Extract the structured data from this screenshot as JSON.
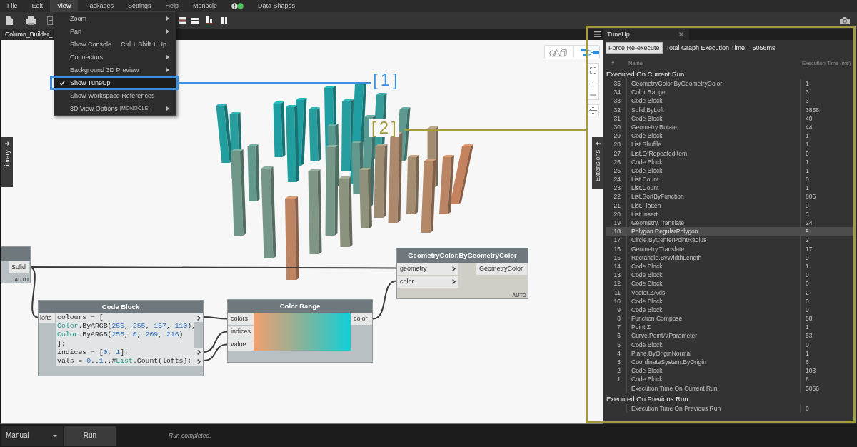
{
  "menu_bar": [
    {
      "kind": "menu",
      "label": "File",
      "open": false
    },
    {
      "kind": "menu",
      "label": "Edit",
      "open": false
    },
    {
      "kind": "menu",
      "label": "View",
      "open": true
    },
    {
      "kind": "menu",
      "label": "Packages",
      "open": false
    },
    {
      "kind": "menu",
      "label": "Settings",
      "open": false
    },
    {
      "kind": "menu",
      "label": "Help",
      "open": false
    },
    {
      "kind": "menu",
      "label": "Monocle",
      "open": false
    },
    {
      "kind": "indicator"
    },
    {
      "kind": "menu",
      "label": "Data Shapes",
      "open": false
    }
  ],
  "view_menu": {
    "items": [
      {
        "label": "Zoom",
        "submenu": true,
        "checked": false,
        "selected": false
      },
      {
        "label": "Pan",
        "submenu": true,
        "checked": false,
        "selected": false
      },
      {
        "label": "Show Console",
        "shortcut": "Ctrl + Shift + Up",
        "submenu": false,
        "checked": false,
        "selected": false
      },
      {
        "label": "Connectors",
        "submenu": true,
        "checked": false,
        "selected": false
      },
      {
        "label": "Background 3D Preview",
        "submenu": true,
        "checked": false,
        "selected": false
      },
      {
        "label": "Show TuneUp",
        "submenu": false,
        "checked": true,
        "selected": true
      },
      {
        "label": "Show Workspace References",
        "submenu": false,
        "checked": false,
        "selected": false
      },
      {
        "label": "3D View Options",
        "tag": "[MONOCLE]",
        "submenu": true,
        "checked": false,
        "selected": false
      }
    ]
  },
  "tabs": [
    {
      "label": "Column_Builder_",
      "selected": true
    }
  ],
  "canvas": {
    "library_tab": {
      "label": "Library"
    },
    "extensions_tab": {
      "label": "Extensions"
    },
    "view_toggle": [
      {
        "kind": "geometry",
        "selected": false
      },
      {
        "kind": "graph",
        "selected": true
      }
    ],
    "nodes": [
      {
        "kind": "partial",
        "outputs": [
          "Solid"
        ],
        "lacing": "AUTO"
      },
      {
        "kind": "code",
        "title": "Code Block",
        "inputs": [
          "lofts"
        ],
        "lines": [
          {
            "output": true,
            "tokens": [
              {
                "kind": "plain",
                "text": "colours = ["
              }
            ]
          },
          {
            "output": false,
            "tokens": [
              {
                "kind": "type",
                "text": "Color"
              },
              {
                "kind": "plain",
                "text": ".ByARGB("
              },
              {
                "kind": "number",
                "text": "255"
              },
              {
                "kind": "plain",
                "text": ", "
              },
              {
                "kind": "number",
                "text": "255"
              },
              {
                "kind": "plain",
                "text": ", "
              },
              {
                "kind": "number",
                "text": "157"
              },
              {
                "kind": "plain",
                "text": ", "
              },
              {
                "kind": "number",
                "text": "110"
              },
              {
                "kind": "plain",
                "text": "),"
              }
            ]
          },
          {
            "output": false,
            "tokens": [
              {
                "kind": "type",
                "text": "Color"
              },
              {
                "kind": "plain",
                "text": ".ByARGB("
              },
              {
                "kind": "number",
                "text": "255"
              },
              {
                "kind": "plain",
                "text": ", "
              },
              {
                "kind": "number",
                "text": "0"
              },
              {
                "kind": "plain",
                "text": ", "
              },
              {
                "kind": "number",
                "text": "209"
              },
              {
                "kind": "plain",
                "text": ", "
              },
              {
                "kind": "number",
                "text": "216"
              },
              {
                "kind": "plain",
                "text": ")"
              }
            ]
          },
          {
            "output": false,
            "tokens": [
              {
                "kind": "plain",
                "text": "];"
              }
            ]
          },
          {
            "output": true,
            "tokens": [
              {
                "kind": "plain",
                "text": "indices = ["
              },
              {
                "kind": "number",
                "text": "0"
              },
              {
                "kind": "plain",
                "text": ", "
              },
              {
                "kind": "number",
                "text": "1"
              },
              {
                "kind": "plain",
                "text": "];"
              }
            ]
          },
          {
            "output": true,
            "tokens": [
              {
                "kind": "plain",
                "text": "vals = "
              },
              {
                "kind": "number",
                "text": "0"
              },
              {
                "kind": "plain",
                "text": ".."
              },
              {
                "kind": "number",
                "text": "1"
              },
              {
                "kind": "plain",
                "text": "..#"
              },
              {
                "kind": "type",
                "text": "List"
              },
              {
                "kind": "plain",
                "text": ".Count(lofts);"
              }
            ]
          }
        ]
      },
      {
        "kind": "color_range",
        "title": "Color Range",
        "inputs": [
          "colors",
          "indices",
          "value"
        ],
        "outputs": [
          "color"
        ]
      },
      {
        "kind": "function",
        "title": "GeometryColor.ByGeometryColor",
        "inputs": [
          "geometry",
          "color"
        ],
        "outputs": [
          "GeometryColor"
        ],
        "lacing": "AUTO"
      }
    ]
  },
  "annotations": [
    {
      "label": "[1]",
      "color": "#3d8de0"
    },
    {
      "label": "[2]",
      "color": "#a39c3c"
    }
  ],
  "tuneup": {
    "title": "TuneUp",
    "force_button": "Force Re-execute",
    "total_label": "Total Graph Execution Time:",
    "total_value": "5056ms",
    "columns": [
      "#",
      "Name",
      "Execution Time (ms)"
    ],
    "groups": [
      {
        "title": "Executed On Current Run",
        "rows": [
          {
            "index": "35",
            "name": "GeometryColor.ByGeometryColor",
            "time": "1",
            "selected": false
          },
          {
            "index": "34",
            "name": "Color Range",
            "time": "3",
            "selected": false
          },
          {
            "index": "33",
            "name": "Code Block",
            "time": "3",
            "selected": false
          },
          {
            "index": "32",
            "name": "Solid.ByLoft",
            "time": "3858",
            "selected": false
          },
          {
            "index": "31",
            "name": "Code Block",
            "time": "40",
            "selected": false
          },
          {
            "index": "30",
            "name": "Geometry.Rotate",
            "time": "44",
            "selected": false
          },
          {
            "index": "29",
            "name": "Code Block",
            "time": "1",
            "selected": false
          },
          {
            "index": "28",
            "name": "List.Shuffle",
            "time": "1",
            "selected": false
          },
          {
            "index": "27",
            "name": "List.OfRepeatedItem",
            "time": "0",
            "selected": false
          },
          {
            "index": "26",
            "name": "Code Block",
            "time": "1",
            "selected": false
          },
          {
            "index": "25",
            "name": "Code Block",
            "time": "1",
            "selected": false
          },
          {
            "index": "24",
            "name": "List.Count",
            "time": "0",
            "selected": false
          },
          {
            "index": "23",
            "name": "List.Count",
            "time": "1",
            "selected": false
          },
          {
            "index": "22",
            "name": "List.SortByFunction",
            "time": "805",
            "selected": false
          },
          {
            "index": "21",
            "name": "List.Flatten",
            "time": "0",
            "selected": false
          },
          {
            "index": "20",
            "name": "List.Insert",
            "time": "3",
            "selected": false
          },
          {
            "index": "19",
            "name": "Geometry.Translate",
            "time": "24",
            "selected": false
          },
          {
            "index": "18",
            "name": "Polygon.RegularPolygon",
            "time": "9",
            "selected": true
          },
          {
            "index": "17",
            "name": "Circle.ByCenterPointRadius",
            "time": "2",
            "selected": false
          },
          {
            "index": "16",
            "name": "Geometry.Translate",
            "time": "17",
            "selected": false
          },
          {
            "index": "15",
            "name": "Rectangle.ByWidthLength",
            "time": "9",
            "selected": false
          },
          {
            "index": "14",
            "name": "Code Block",
            "time": "1",
            "selected": false
          },
          {
            "index": "13",
            "name": "Code Block",
            "time": "0",
            "selected": false
          },
          {
            "index": "12",
            "name": "Code Block",
            "time": "0",
            "selected": false
          },
          {
            "index": "11",
            "name": "Vector.ZAxis",
            "time": "2",
            "selected": false
          },
          {
            "index": "10",
            "name": "Code Block",
            "time": "0",
            "selected": false
          },
          {
            "index": "9",
            "name": "Code Block",
            "time": "0",
            "selected": false
          },
          {
            "index": "8",
            "name": "Function Compose",
            "time": "58",
            "selected": false
          },
          {
            "index": "7",
            "name": "Point.Z",
            "time": "1",
            "selected": false
          },
          {
            "index": "6",
            "name": "Curve.PointAtParameter",
            "time": "53",
            "selected": false
          },
          {
            "index": "5",
            "name": "Code Block",
            "time": "0",
            "selected": false
          },
          {
            "index": "4",
            "name": "Plane.ByOriginNormal",
            "time": "1",
            "selected": false
          },
          {
            "index": "3",
            "name": "CoordinateSystem.ByOrigin",
            "time": "6",
            "selected": false
          },
          {
            "index": "2",
            "name": "Code Block",
            "time": "103",
            "selected": false
          },
          {
            "index": "1",
            "name": "Code Block",
            "time": "8",
            "selected": false
          },
          {
            "name": "Execution Time On Current Run",
            "time": "5056",
            "selected": false
          }
        ]
      },
      {
        "title": "Executed On Previous Run",
        "rows": [
          {
            "name": "Execution Time On Previous Run",
            "time": "0",
            "selected": false
          }
        ]
      }
    ]
  },
  "status_bar": {
    "run_mode": "Manual",
    "run_button": "Run",
    "message": "Run completed."
  }
}
